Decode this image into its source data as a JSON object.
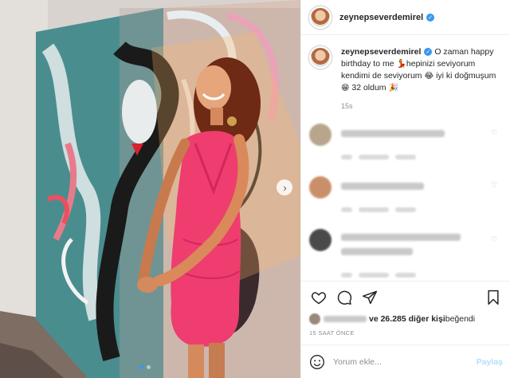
{
  "post": {
    "username": "zeynepseverdemirel",
    "verified_icon": "verified-badge-icon",
    "caption": {
      "username": "zeynepseverdemirel",
      "text_1": "O zaman happy birthday to me ",
      "emoji_1": "💃",
      "text_2": "hepinizi seviyorum kendimi de seviyorum ",
      "emoji_2": "😂",
      "text_3": " iyi ki doğmuşum ",
      "emoji_3": "😁",
      "text_4": " 32 oldum ",
      "emoji_4": "🎉"
    },
    "caption_time": "15s"
  },
  "photo": {
    "carousel_next_glyph": "›",
    "slide_count": 2,
    "active_slide": 1
  },
  "likes": {
    "count_text": "ve 26.285 diğer kişi",
    "suffix": " beğendi"
  },
  "posted_ago": "15 SAAT ÖNCE",
  "add_comment": {
    "placeholder": "Yorum ekle...",
    "post_label": "Paylaş"
  },
  "colors": {
    "accent": "#3897f0",
    "post_disabled": "#b2dffc",
    "dress": "#ee3d6e"
  }
}
